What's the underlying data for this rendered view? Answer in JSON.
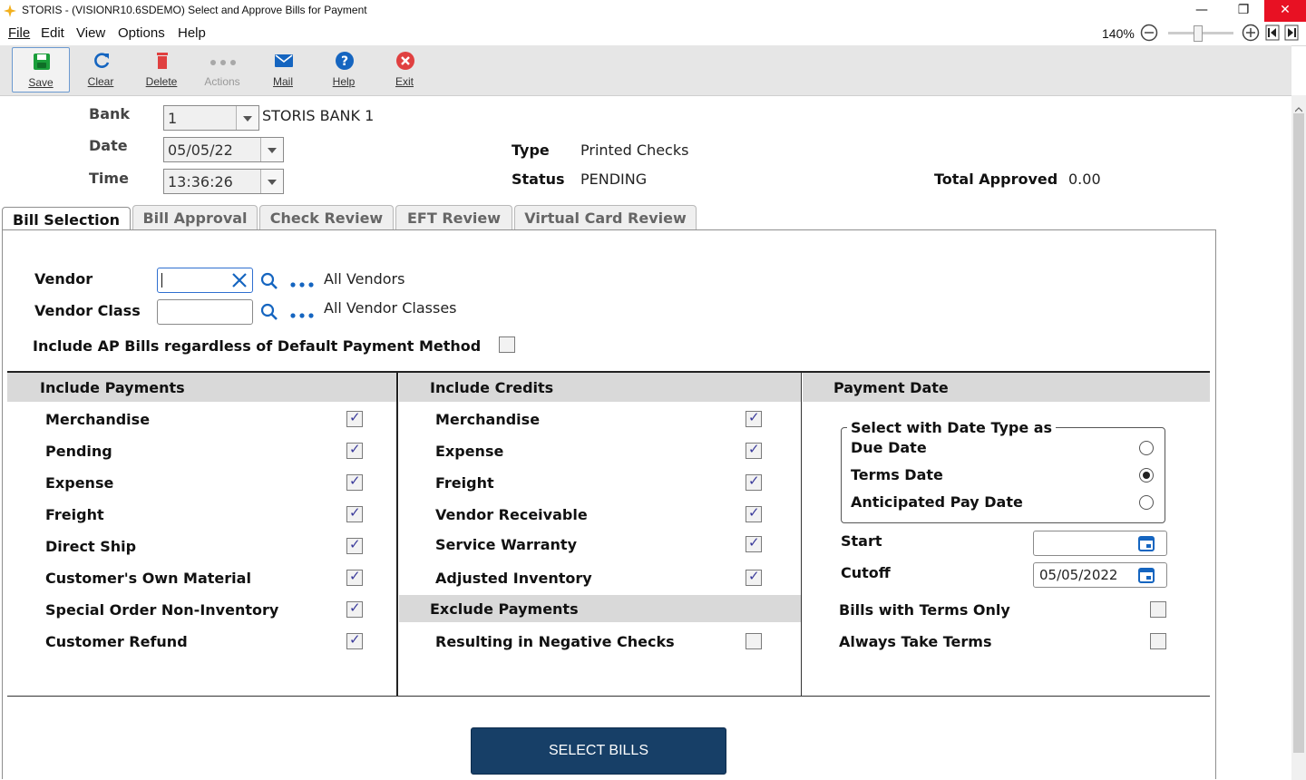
{
  "window": {
    "title": "STORIS - (VISIONR10.6SDEMO) Select and Approve Bills for Payment",
    "minimize": "—",
    "restore": "❐",
    "close": "✕"
  },
  "menu": {
    "items": [
      {
        "label": "File"
      },
      {
        "label": "Edit"
      },
      {
        "label": "View"
      },
      {
        "label": "Options"
      },
      {
        "label": "Help"
      }
    ],
    "zoom": "140%"
  },
  "toolbar": {
    "save": "Save",
    "clear": "Clear",
    "delete": "Delete",
    "actions": "Actions",
    "mail": "Mail",
    "help": "Help",
    "exit": "Exit"
  },
  "header": {
    "bank_label": "Bank",
    "bank_value": "1",
    "bank_name": "STORIS BANK 1",
    "date_label": "Date",
    "date_value": "05/05/22",
    "time_label": "Time",
    "time_value": "13:36:26",
    "type_label": "Type",
    "type_value": "Printed Checks",
    "status_label": "Status",
    "status_value": "PENDING",
    "total_label": "Total Approved",
    "total_value": "0.00"
  },
  "tabs": [
    {
      "label": "Bill Selection",
      "active": true
    },
    {
      "label": "Bill Approval"
    },
    {
      "label": "Check Review"
    },
    {
      "label": "EFT Review"
    },
    {
      "label": "Virtual Card Review"
    }
  ],
  "filters": {
    "vendor_label": "Vendor",
    "vendor_value": "",
    "vendor_desc": "All Vendors",
    "vendor_class_label": "Vendor Class",
    "vendor_class_value": "",
    "vendor_class_desc": "All Vendor Classes",
    "include_ap_label": "Include AP Bills regardless of Default Payment Method",
    "include_ap_checked": false
  },
  "include_payments": {
    "title": "Include Payments",
    "items": [
      {
        "label": "Merchandise",
        "checked": true
      },
      {
        "label": "Pending",
        "checked": true
      },
      {
        "label": "Expense",
        "checked": true
      },
      {
        "label": "Freight",
        "checked": true
      },
      {
        "label": "Direct Ship",
        "checked": true
      },
      {
        "label": "Customer's Own Material",
        "checked": true
      },
      {
        "label": "Special Order Non-Inventory",
        "checked": true
      },
      {
        "label": "Customer Refund",
        "checked": true
      }
    ]
  },
  "include_credits": {
    "title": "Include Credits",
    "items": [
      {
        "label": "Merchandise",
        "checked": true
      },
      {
        "label": "Expense",
        "checked": true
      },
      {
        "label": "Freight",
        "checked": true
      },
      {
        "label": "Vendor Receivable",
        "checked": true
      },
      {
        "label": "Service Warranty",
        "checked": true
      },
      {
        "label": "Adjusted Inventory",
        "checked": true
      }
    ]
  },
  "exclude_payments": {
    "title": "Exclude Payments",
    "items": [
      {
        "label": "Resulting in Negative Checks",
        "checked": false
      }
    ]
  },
  "payment_date": {
    "title": "Payment Date",
    "group_title": "Select with Date Type as",
    "options": [
      {
        "label": "Due Date",
        "selected": false
      },
      {
        "label": "Terms Date",
        "selected": true
      },
      {
        "label": "Anticipated Pay Date",
        "selected": false
      }
    ],
    "start_label": "Start",
    "start_value": "",
    "cutoff_label": "Cutoff",
    "cutoff_value": "05/05/2022",
    "terms_only_label": "Bills with Terms Only",
    "terms_only_checked": false,
    "always_take_label": "Always Take Terms",
    "always_take_checked": false
  },
  "select_button": "SELECT BILLS",
  "colors": {
    "accent": "#173f67",
    "close_red": "#e81123",
    "save_green": "#1a9e3a",
    "delete_red": "#e04040",
    "link_blue": "#1565c0"
  }
}
